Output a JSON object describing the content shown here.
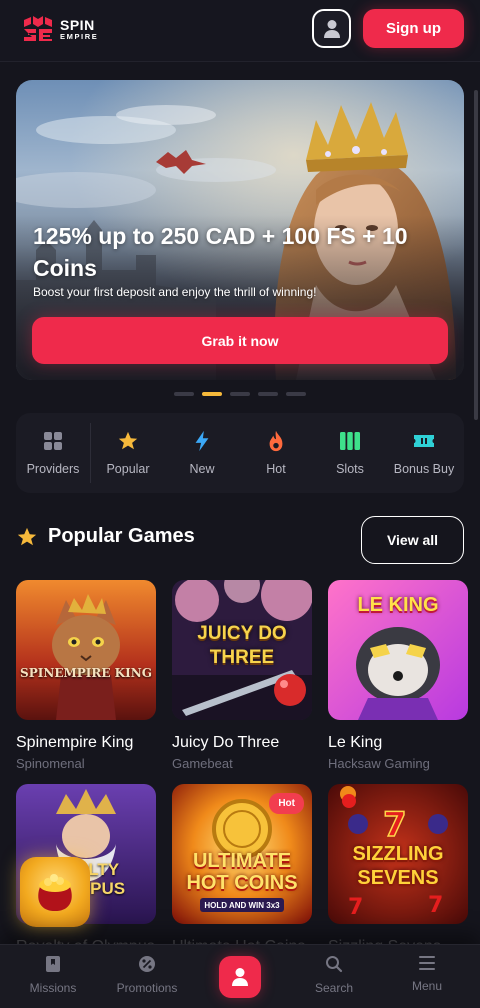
{
  "header": {
    "logo_line1": "SPIN",
    "logo_line2": "EMPIRE",
    "account_icon": "user-icon",
    "signup_label": "Sign up"
  },
  "hero": {
    "title": "125% up to 250 CAD + 100 FS + 10 Coins",
    "subtitle": "Boost your first deposit and enjoy the thrill of winning!",
    "cta": "Grab it now",
    "slide_count": 5,
    "active_slide": 2
  },
  "categories": [
    {
      "label": "Providers",
      "icon": "grid-icon",
      "color": "#8a8a98"
    },
    {
      "label": "Popular",
      "icon": "star-icon",
      "color": "#f6b93b"
    },
    {
      "label": "New",
      "icon": "lightning-icon",
      "color": "#3ba8f6"
    },
    {
      "label": "Hot",
      "icon": "flame-icon",
      "color": "#ff6a3d"
    },
    {
      "label": "Slots",
      "icon": "slots-icon",
      "color": "#3ee08a"
    },
    {
      "label": "Bonus Buy",
      "icon": "ticket-icon",
      "color": "#2fd1d6"
    }
  ],
  "popular": {
    "title": "Popular Games",
    "view_all": "View all",
    "games": [
      {
        "name": "Spinempire King",
        "provider": "Spinomenal",
        "thumb_text": "SPINEMPIRE KING"
      },
      {
        "name": "Juicy Do Three",
        "provider": "Gamebeat",
        "thumb_text": "JUICY DO THREE"
      },
      {
        "name": "Le King",
        "provider": "Hacksaw Gaming",
        "thumb_text": "LE KING"
      },
      {
        "name": "Royalty of Olympus",
        "provider": "",
        "thumb_text": "ALTY MPUS"
      },
      {
        "name": "Ultimate Hot Coins",
        "provider": "",
        "thumb_text": "ULTIMATE HOT COINS",
        "thumb_sub": "HOLD AND WIN 3x3",
        "badge": "Hot"
      },
      {
        "name": "Sizzling Sevens",
        "provider": "",
        "thumb_text": "SIZZLING SEVENS"
      }
    ]
  },
  "nav": {
    "items": [
      {
        "label": "Missions",
        "icon": "book-icon"
      },
      {
        "label": "Promotions",
        "icon": "percent-icon"
      },
      {
        "label": "",
        "icon": "user-icon"
      },
      {
        "label": "Search",
        "icon": "search-icon"
      },
      {
        "label": "Menu",
        "icon": "menu-icon"
      }
    ]
  },
  "colors": {
    "accent": "#ef2a4b",
    "background": "#15151d",
    "card": "#1b1b24",
    "star": "#f6b93b"
  }
}
